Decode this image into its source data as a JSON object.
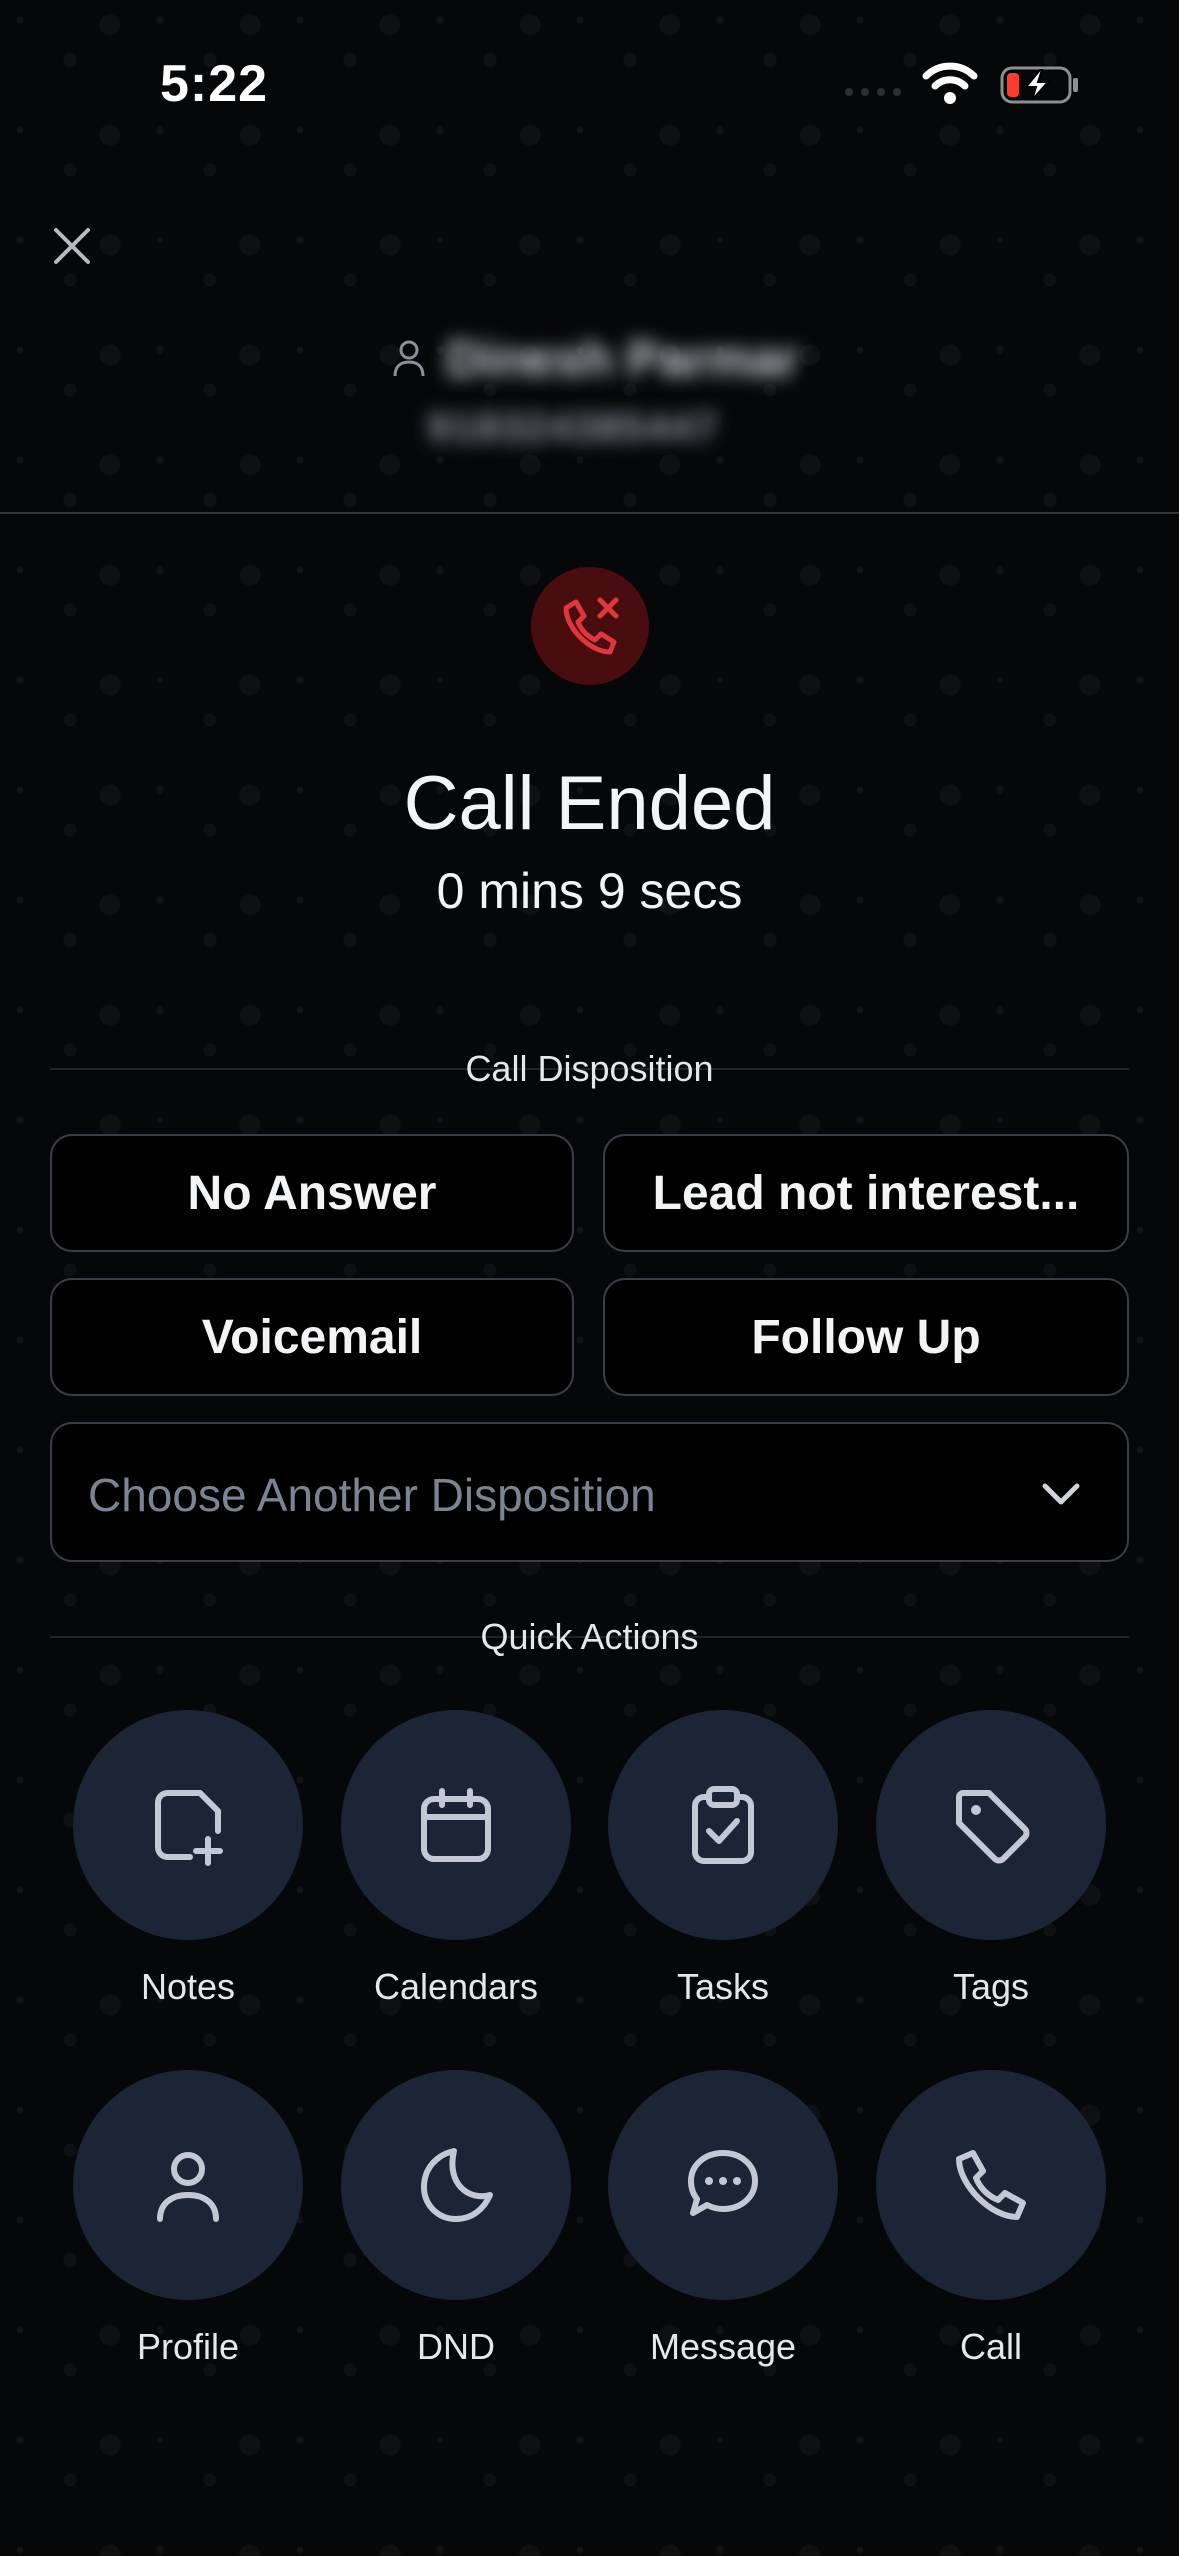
{
  "status_bar": {
    "time": "5:22"
  },
  "contact": {
    "name": "Dinesh Parmar",
    "phone": "918324385447"
  },
  "call": {
    "title": "Call Ended",
    "duration": "0 mins 9 secs"
  },
  "disposition": {
    "section_label": "Call Disposition",
    "buttons": [
      {
        "label": "No Answer"
      },
      {
        "label": "Lead not interest..."
      },
      {
        "label": "Voicemail"
      },
      {
        "label": "Follow Up"
      }
    ],
    "select_placeholder": "Choose Another Disposition"
  },
  "quick_actions": {
    "section_label": "Quick Actions",
    "items": [
      {
        "label": "Notes",
        "icon": "note-add-icon"
      },
      {
        "label": "Calendars",
        "icon": "calendar-icon"
      },
      {
        "label": "Tasks",
        "icon": "clipboard-check-icon"
      },
      {
        "label": "Tags",
        "icon": "tag-icon"
      },
      {
        "label": "Profile",
        "icon": "user-icon"
      },
      {
        "label": "DND",
        "icon": "moon-icon"
      },
      {
        "label": "Message",
        "icon": "chat-bubble-icon"
      },
      {
        "label": "Call",
        "icon": "phone-icon"
      }
    ]
  },
  "colors": {
    "background": "#060709",
    "action_circle": "#1c2535",
    "end_call_badge": "#4a0d0f",
    "end_call_accent": "#e0373f",
    "border": "#3a3f47"
  }
}
